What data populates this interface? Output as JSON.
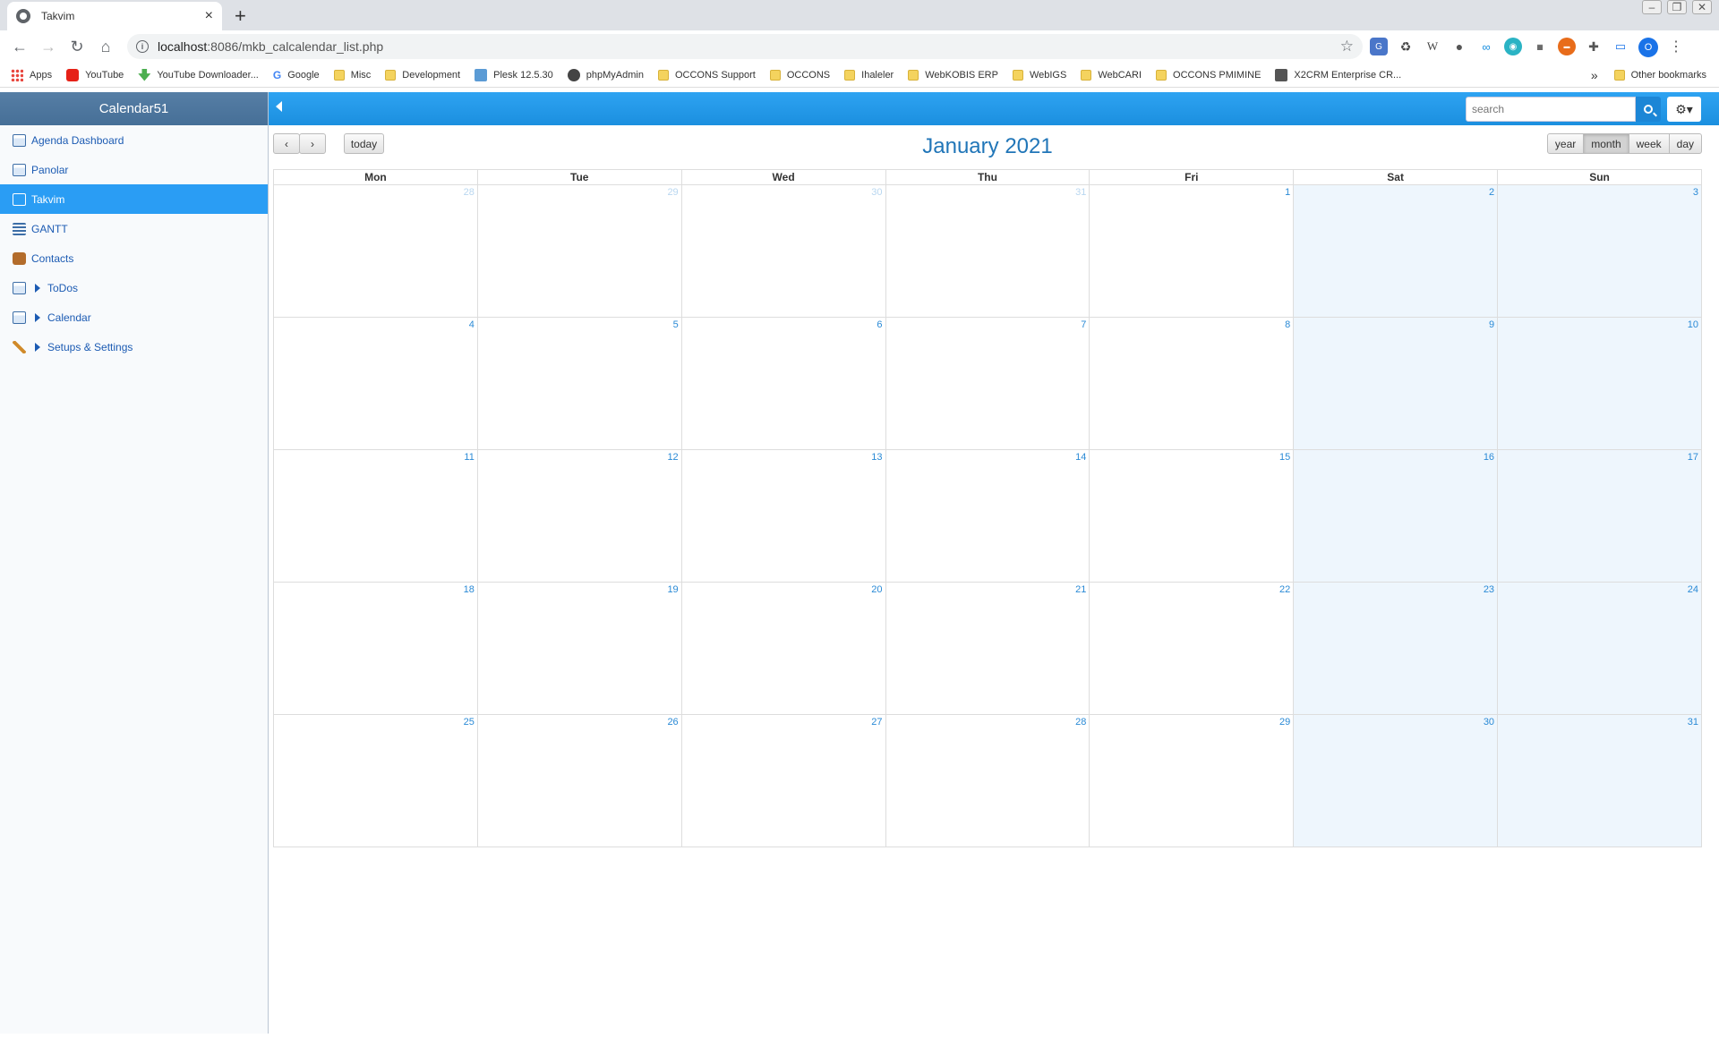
{
  "browser": {
    "tab_title": "Takvim",
    "tab_close": "×",
    "new_tab": "+",
    "url_host": "localhost",
    "url_path": ":8086/mkb_calcalendar_list.php",
    "profile_initial": "O",
    "bookmarks": [
      {
        "label": "Apps",
        "icon": "apps-icon"
      },
      {
        "label": "YouTube",
        "icon": "youtube-icon"
      },
      {
        "label": "YouTube Downloader...",
        "icon": "download-icon"
      },
      {
        "label": "Google",
        "icon": "google-icon"
      },
      {
        "label": "Misc",
        "icon": "folder-icon"
      },
      {
        "label": "Development",
        "icon": "folder-icon"
      },
      {
        "label": "Plesk 12.5.30",
        "icon": "plesk-icon"
      },
      {
        "label": "phpMyAdmin",
        "icon": "globe-icon"
      },
      {
        "label": "OCCONS Support",
        "icon": "folder-icon"
      },
      {
        "label": "OCCONS",
        "icon": "folder-icon"
      },
      {
        "label": "Ihaleler",
        "icon": "folder-icon"
      },
      {
        "label": "WebKOBIS ERP",
        "icon": "folder-icon"
      },
      {
        "label": "WebIGS",
        "icon": "folder-icon"
      },
      {
        "label": "WebCARI",
        "icon": "folder-icon"
      },
      {
        "label": "OCCONS PMIMINE",
        "icon": "folder-icon"
      },
      {
        "label": "X2CRM Enterprise CR...",
        "icon": "x2crm-icon"
      }
    ],
    "more_bookmarks": "»",
    "other_bookmarks": "Other bookmarks"
  },
  "sidebar": {
    "brand": "Calendar51",
    "items": [
      {
        "label": "Agenda Dashboard",
        "expandable": false
      },
      {
        "label": "Panolar",
        "expandable": false
      },
      {
        "label": "Takvim",
        "expandable": false,
        "active": true
      },
      {
        "label": "GANTT",
        "expandable": false
      },
      {
        "label": "Contacts",
        "expandable": false
      },
      {
        "label": "ToDos",
        "expandable": true
      },
      {
        "label": "Calendar",
        "expandable": true
      },
      {
        "label": "Setups & Settings",
        "expandable": true
      }
    ]
  },
  "topbar": {
    "search_placeholder": "search",
    "gear_label": "⚙▾"
  },
  "calendar": {
    "title": "January 2021",
    "prev": "‹",
    "next": "›",
    "today_label": "today",
    "views": [
      "year",
      "month",
      "week",
      "day"
    ],
    "active_view": "month",
    "weekdays": [
      "Mon",
      "Tue",
      "Wed",
      "Thu",
      "Fri",
      "Sat",
      "Sun"
    ],
    "weeks": [
      [
        {
          "d": "28",
          "o": true
        },
        {
          "d": "29",
          "o": true
        },
        {
          "d": "30",
          "o": true
        },
        {
          "d": "31",
          "o": true
        },
        {
          "d": "1"
        },
        {
          "d": "2"
        },
        {
          "d": "3"
        }
      ],
      [
        {
          "d": "4"
        },
        {
          "d": "5"
        },
        {
          "d": "6"
        },
        {
          "d": "7"
        },
        {
          "d": "8"
        },
        {
          "d": "9"
        },
        {
          "d": "10"
        }
      ],
      [
        {
          "d": "11"
        },
        {
          "d": "12"
        },
        {
          "d": "13"
        },
        {
          "d": "14"
        },
        {
          "d": "15"
        },
        {
          "d": "16"
        },
        {
          "d": "17"
        }
      ],
      [
        {
          "d": "18"
        },
        {
          "d": "19"
        },
        {
          "d": "20"
        },
        {
          "d": "21"
        },
        {
          "d": "22"
        },
        {
          "d": "23"
        },
        {
          "d": "24"
        }
      ],
      [
        {
          "d": "25"
        },
        {
          "d": "26"
        },
        {
          "d": "27"
        },
        {
          "d": "28"
        },
        {
          "d": "29"
        },
        {
          "d": "30"
        },
        {
          "d": "31"
        }
      ]
    ]
  },
  "colors": {
    "accent": "#2a9df4",
    "brand_bar": "#4f789f",
    "weekend_bg": "#eef6fd",
    "day_number": "#2a8ad6"
  }
}
